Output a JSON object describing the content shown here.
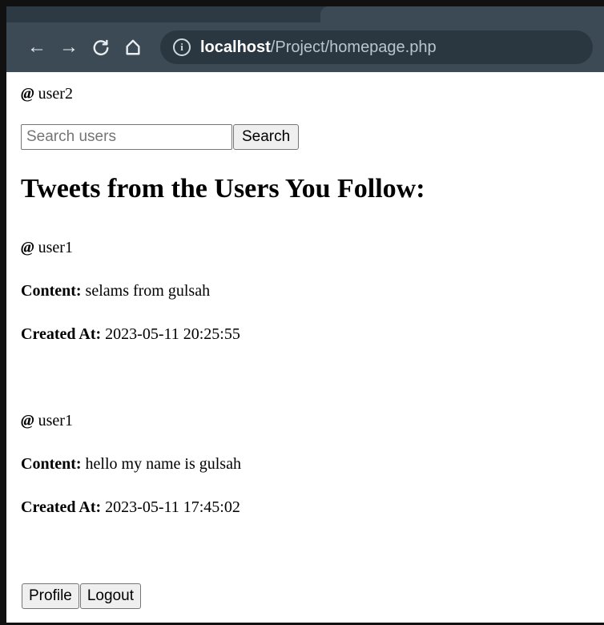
{
  "browser": {
    "url_host": "localhost",
    "url_path": "/Project/homepage.php",
    "nav": {
      "back_glyph": "←",
      "forward_glyph": "→",
      "reload_glyph": "C",
      "home_glyph": "⌂"
    }
  },
  "header": {
    "at_symbol": "@",
    "username": "user2"
  },
  "search": {
    "placeholder": "Search users",
    "value": "",
    "button_label": "Search"
  },
  "feed": {
    "title": "Tweets from the Users You Follow:",
    "content_label": "Content:",
    "created_label": "Created At:",
    "tweets": [
      {
        "username": "user1",
        "content": "selams from gulsah",
        "created_at": "2023-05-11 20:25:55"
      },
      {
        "username": "user1",
        "content": "hello my name is gulsah",
        "created_at": "2023-05-11 17:45:02"
      }
    ]
  },
  "footer": {
    "profile_label": "Profile",
    "logout_label": "Logout"
  }
}
